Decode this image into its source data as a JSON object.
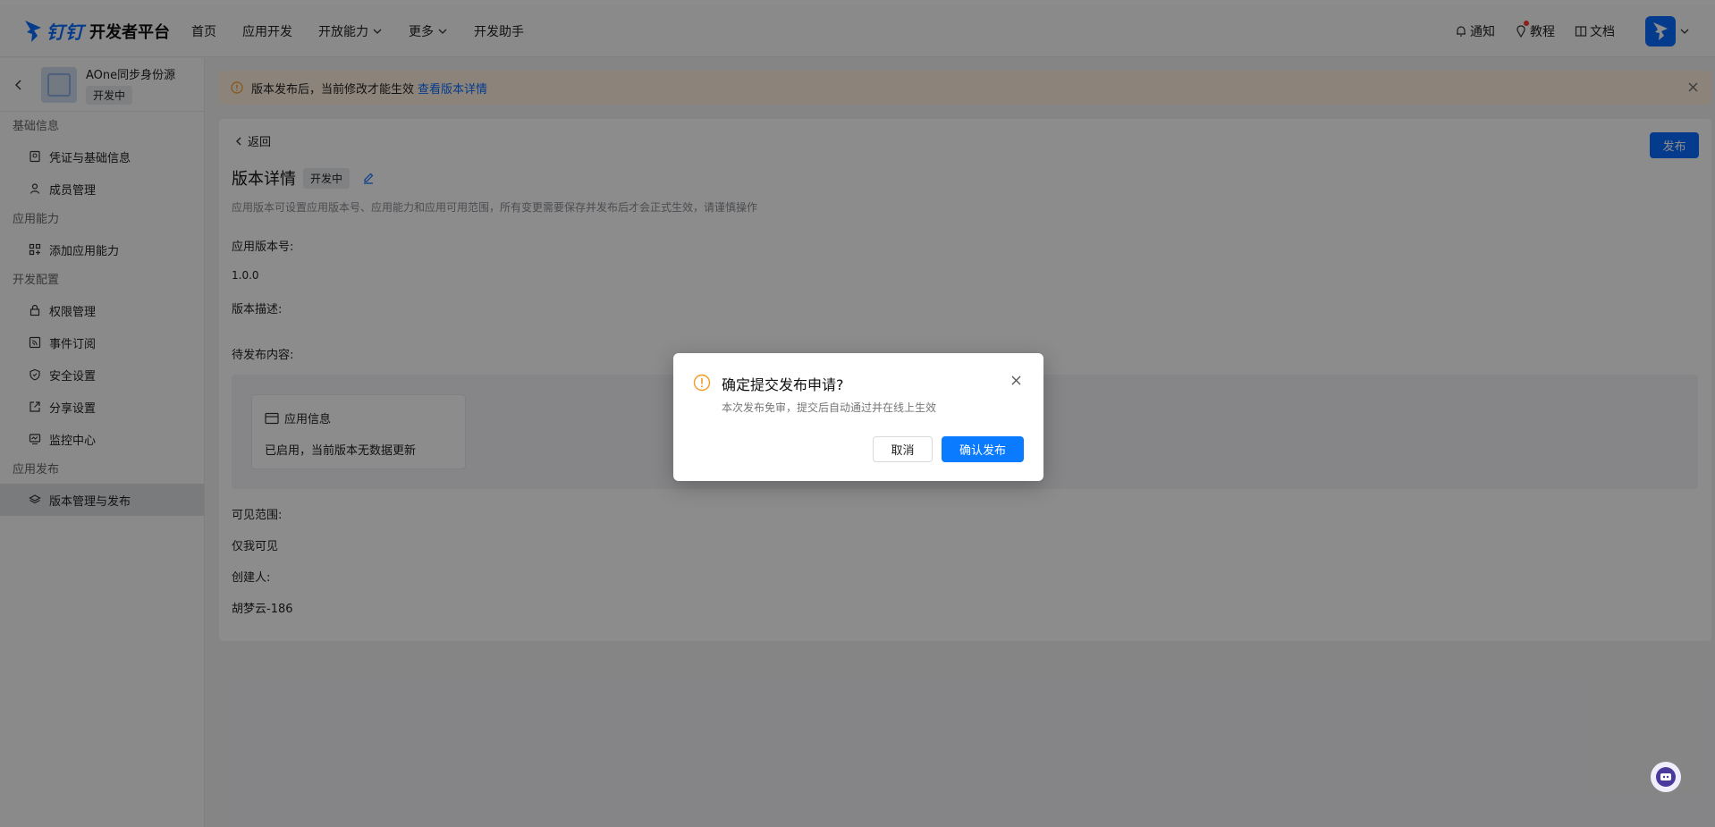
{
  "brand": {
    "ding": "钉钉",
    "name": "开发者平台"
  },
  "nav": [
    {
      "label": "首页",
      "dropdown": false
    },
    {
      "label": "应用开发",
      "dropdown": false
    },
    {
      "label": "开放能力",
      "dropdown": true
    },
    {
      "label": "更多",
      "dropdown": true
    },
    {
      "label": "开发助手",
      "dropdown": false
    }
  ],
  "header_right": {
    "notify": "通知",
    "tutorial": "教程",
    "docs": "文档"
  },
  "app": {
    "name": "AOne同步身份源",
    "status": "开发中"
  },
  "sidebar": {
    "sections": [
      {
        "title": "基础信息",
        "items": [
          {
            "label": "凭证与基础信息",
            "icon": "credential-icon"
          },
          {
            "label": "成员管理",
            "icon": "user-icon"
          }
        ]
      },
      {
        "title": "应用能力",
        "items": [
          {
            "label": "添加应用能力",
            "icon": "apps-add-icon"
          }
        ]
      },
      {
        "title": "开发配置",
        "items": [
          {
            "label": "权限管理",
            "icon": "lock-icon"
          },
          {
            "label": "事件订阅",
            "icon": "rss-icon"
          },
          {
            "label": "安全设置",
            "icon": "shield-icon"
          },
          {
            "label": "分享设置",
            "icon": "share-icon"
          },
          {
            "label": "监控中心",
            "icon": "monitor-icon"
          }
        ]
      },
      {
        "title": "应用发布",
        "items": [
          {
            "label": "版本管理与发布",
            "icon": "layers-icon",
            "active": true
          }
        ]
      }
    ]
  },
  "alert": {
    "message": "版本发布后，当前修改才能生效",
    "link": "查看版本详情"
  },
  "main": {
    "back": "返回",
    "publish": "发布",
    "title": "版本详情",
    "status": "开发中",
    "description": "应用版本可设置应用版本号、应用能力和应用可用范围，所有变更需要保存并发布后才会正式生效，请谨慎操作",
    "version_label": "应用版本号:",
    "version_value": "1.0.0",
    "desc_label": "版本描述:",
    "pending_label": "待发布内容:",
    "pending_card": {
      "title": "应用信息",
      "body": "已启用，当前版本无数据更新"
    },
    "scope_label": "可见范围:",
    "scope_value": "仅我可见",
    "creator_label": "创建人:",
    "creator_value": "胡梦云-186"
  },
  "modal": {
    "title": "确定提交发布申请?",
    "description": "本次发布免审，提交后自动通过并在线上生效",
    "cancel": "取消",
    "confirm": "确认发布"
  },
  "colors": {
    "primary": "#0a6cff",
    "warning": "#f59a23",
    "alert_bg": "#fff1df"
  }
}
